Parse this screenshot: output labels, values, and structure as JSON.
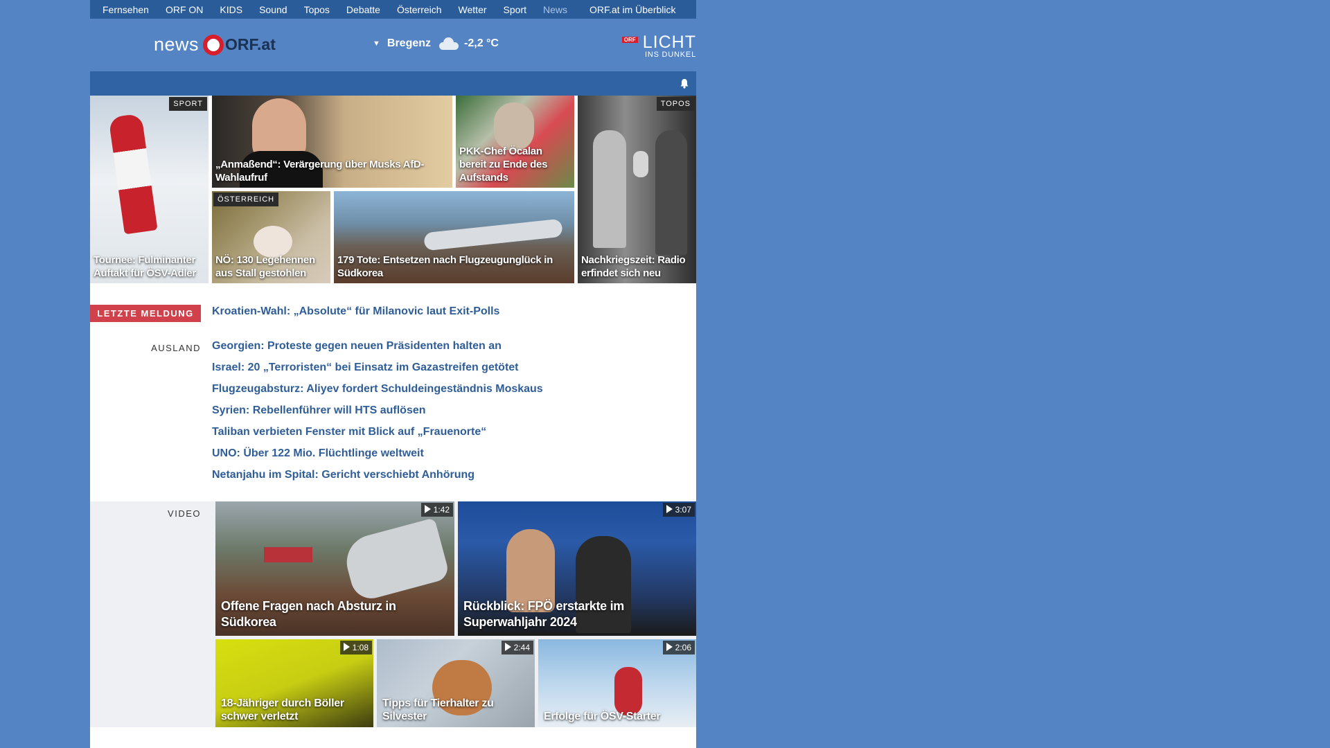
{
  "topnav": {
    "items": [
      "Fernsehen",
      "ORF ON",
      "KIDS",
      "Sound",
      "Topos",
      "Debatte",
      "Österreich",
      "Wetter",
      "Sport",
      "News"
    ],
    "overview": "ORF.at im Überblick"
  },
  "header": {
    "logo_news": "news",
    "logo_orf": "ORF.at",
    "weather_location": "Bregenz",
    "weather_temp": "-2,2 °C",
    "promo_badge": "ORF",
    "promo_title": "LICHT",
    "promo_subtitle": "INS DUNKEL"
  },
  "top_tiles": [
    {
      "tag": "SPORT",
      "caption": "Tournee: Fulminanter Auftakt für ÖSV-Adler"
    },
    {
      "tag": "",
      "caption": "„Anmaßend“: Verärgerung über Musks AfD-Wahlaufruf"
    },
    {
      "tag": "",
      "caption": "PKK-Chef Öcalan bereit zu Ende des Aufstands"
    },
    {
      "tag": "TOPOS",
      "caption": "Nachkriegszeit: Radio erfindet sich neu"
    },
    {
      "tag": "ÖSTERREICH",
      "caption": "NÖ: 130 Legehennen aus Stall gestohlen"
    },
    {
      "tag": "",
      "caption": "179 Tote: Entsetzen nach Flugzeugunglück in Südkorea"
    }
  ],
  "breaking": {
    "label": "LETZTE MELDUNG",
    "headline": "Kroatien-Wahl: „Absolute“ für Milanovic laut Exit-Polls"
  },
  "ausland": {
    "label": "AUSLAND",
    "stories": [
      "Georgien: Proteste gegen neuen Präsidenten halten an",
      "Israel: 20 „Terroristen“ bei Einsatz im Gazastreifen getötet",
      "Flugzeugabsturz: Aliyev fordert Schuldeingeständnis Moskaus",
      "Syrien: Rebellenführer will HTS auflösen",
      "Taliban verbieten Fenster mit Blick auf „Frauenorte“",
      "UNO: Über 122 Mio. Flüchtlinge weltweit",
      "Netanjahu im Spital: Gericht verschiebt Anhörung"
    ]
  },
  "video": {
    "label": "VIDEO",
    "items": [
      {
        "duration": "1:42",
        "caption": "Offene Fragen nach Absturz in Südkorea"
      },
      {
        "duration": "3:07",
        "caption": "Rückblick: FPÖ erstarkte im Superwahljahr 2024"
      },
      {
        "duration": "1:08",
        "caption": "18-Jähriger durch Böller schwer verletzt"
      },
      {
        "duration": "2:44",
        "caption": "Tipps für Tierhalter zu Silvester"
      },
      {
        "duration": "2:06",
        "caption": "Erfolge für ÖSV-Starter"
      }
    ]
  },
  "colors": {
    "background": "#5484c4",
    "nav": "#2a5c9a",
    "link": "#2f5d98",
    "breaking": "#d0414b"
  }
}
